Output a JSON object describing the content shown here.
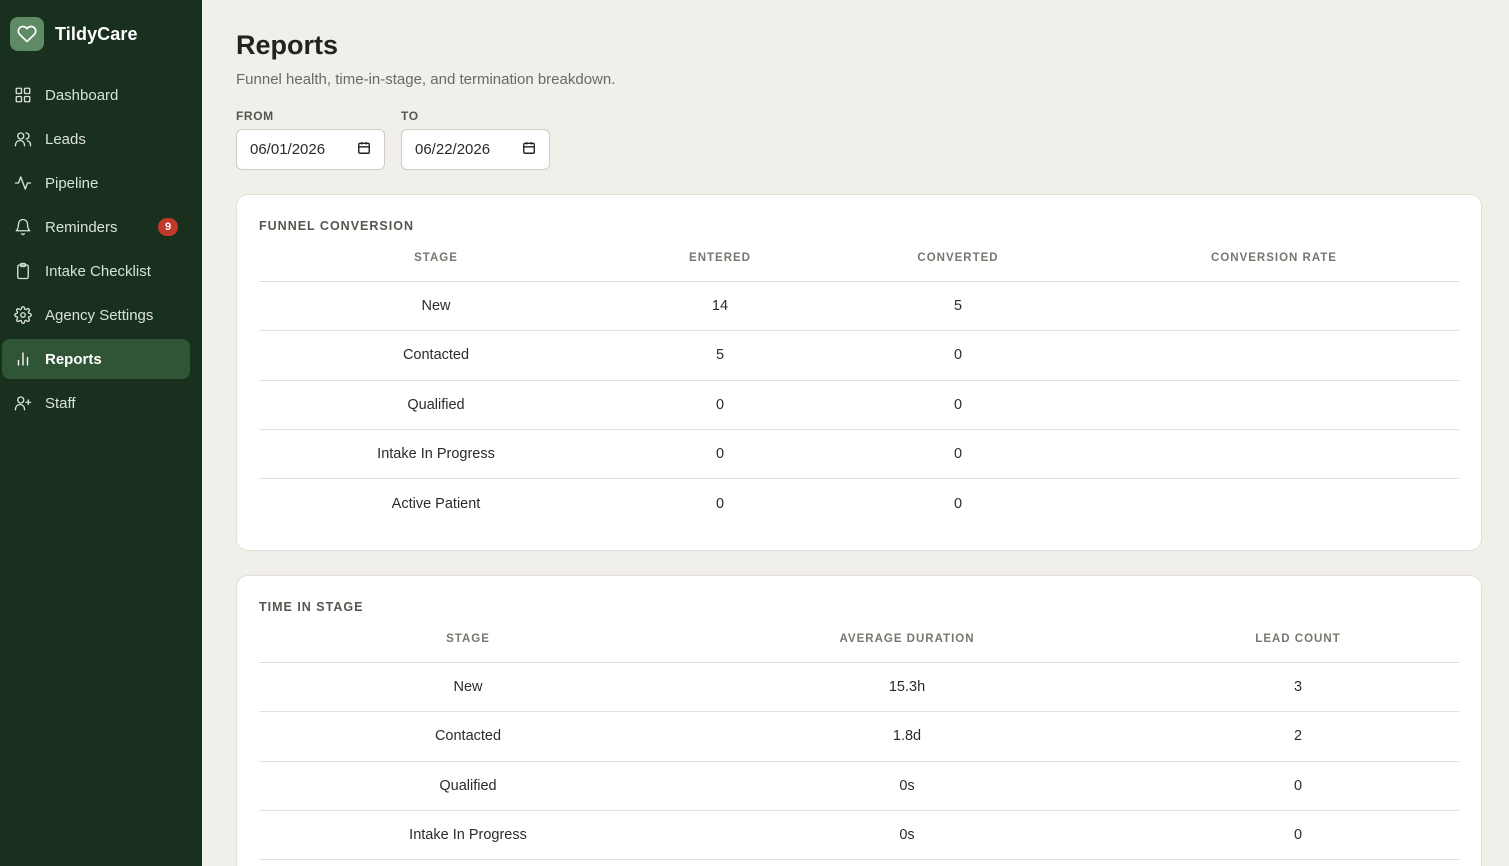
{
  "brand": {
    "name": "TildyCare"
  },
  "nav": [
    {
      "label": "Dashboard",
      "icon": "grid-icon"
    },
    {
      "label": "Leads",
      "icon": "users-icon"
    },
    {
      "label": "Pipeline",
      "icon": "activity-icon"
    },
    {
      "label": "Reminders",
      "icon": "bell-icon",
      "badge": "9"
    },
    {
      "label": "Intake Checklist",
      "icon": "clipboard-icon"
    },
    {
      "label": "Agency Settings",
      "icon": "gear-icon"
    },
    {
      "label": "Reports",
      "icon": "bar-chart-icon",
      "active": true
    },
    {
      "label": "Staff",
      "icon": "user-plus-icon"
    }
  ],
  "page": {
    "title": "Reports",
    "subtitle": "Funnel health, time-in-stage, and termination breakdown."
  },
  "filters": {
    "from_label": "FROM",
    "from_value": "06/01/2026",
    "to_label": "TO",
    "to_value": "06/22/2026"
  },
  "funnel": {
    "title": "FUNNEL CONVERSION",
    "headers": [
      "STAGE",
      "ENTERED",
      "CONVERTED",
      "CONVERSION RATE"
    ],
    "rows": [
      [
        "New",
        "14",
        "5",
        ""
      ],
      [
        "Contacted",
        "5",
        "0",
        ""
      ],
      [
        "Qualified",
        "0",
        "0",
        ""
      ],
      [
        "Intake In Progress",
        "0",
        "0",
        ""
      ],
      [
        "Active Patient",
        "0",
        "0",
        ""
      ]
    ]
  },
  "time_in_stage": {
    "title": "TIME IN STAGE",
    "headers": [
      "STAGE",
      "AVERAGE DURATION",
      "LEAD COUNT"
    ],
    "rows": [
      [
        "New",
        "15.3h",
        "3"
      ],
      [
        "Contacted",
        "1.8d",
        "2"
      ],
      [
        "Qualified",
        "0s",
        "0"
      ],
      [
        "Intake In Progress",
        "0s",
        "0"
      ]
    ]
  },
  "colors": {
    "sidebar_bg": "#19301f",
    "active_nav": "#2f5436",
    "badge": "#c0392b",
    "page_bg": "#f1efea"
  }
}
